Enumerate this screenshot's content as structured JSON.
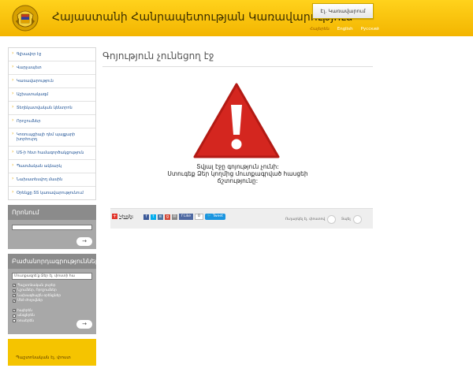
{
  "header": {
    "title": "Հայաստանի Հանրապետության Կառավարություն",
    "email_button": "Էլ. Կառավարում",
    "languages": [
      {
        "label": "Հայերեն",
        "active": true
      },
      {
        "label": "English",
        "active": false
      },
      {
        "label": "Русский",
        "active": false
      }
    ]
  },
  "sidebar": {
    "nav": [
      "Գլխավոր էջ",
      "Վարչապետ",
      "Կառավարություն",
      "Աշխատակազմ",
      "Տեղեկատվական կենտրոն",
      "Որոշումներ",
      "Կոռուպցիայի դեմ պայքարի խորհուրդ",
      "ՍՏ-ի հետ համագործակցություն",
      "Պատմական ակնարկ",
      "Նախատեսվող մասին",
      "Օրենքը ՏՏ կառավարությունում"
    ],
    "search": {
      "title": "Որոնում",
      "go": "→"
    },
    "subscribe": {
      "title": "Բաժանորդագրություններ",
      "input_value": "Մուտքագրե՛ք Ձեր էլ. փոստի հա",
      "checks_group1": [
        {
          "label": "Պաշտոնական լուրեր",
          "checked": true
        },
        {
          "label": "Նշումներ, Որոշումներ",
          "checked": true
        },
        {
          "label": "Նախագծային օրենքներ",
          "checked": true
        },
        {
          "label": "Մեծ ժողովներ",
          "checked": true
        }
      ],
      "checks_group2": [
        {
          "label": "հայերեն",
          "checked": true
        },
        {
          "label": "անգլերեն",
          "checked": false
        },
        {
          "label": "ռուսերեն",
          "checked": false
        }
      ],
      "go": "→"
    },
    "promo": "Պաշտոնական էլ. փոստ"
  },
  "main": {
    "title": "Գոյություն չունեցող էջ",
    "message_line1": "Տվյալ էջը գոյություն չունի:",
    "message_line2": "Ստուգեք Ձեր կողմից մուտքագրված հասցեի",
    "message_line3": "ճշտությունը:",
    "share": {
      "label": "Կիսվել",
      "like": "Like",
      "like_count": "0",
      "tweet": "Tweet",
      "send_email": "Ուղարկել էլ. փոստով",
      "print": "Տպել"
    }
  },
  "colors": {
    "header_yellow": "#ffd21c",
    "warning_red": "#d4261f",
    "link_blue": "#1a4f93",
    "sidebar_gray": "#8b8b8b"
  }
}
